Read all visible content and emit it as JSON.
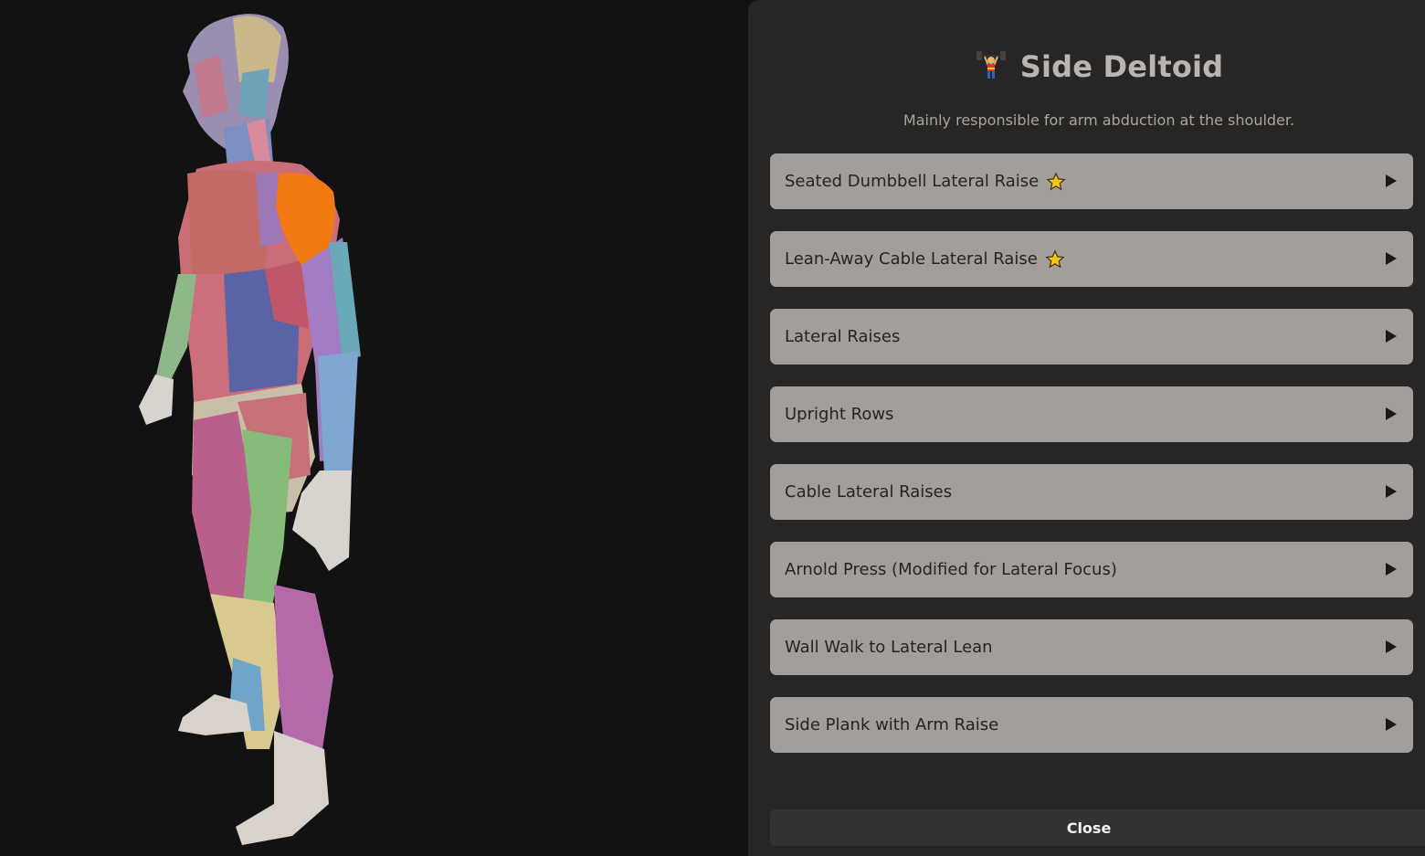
{
  "modal": {
    "icon": "weightlifter-icon",
    "title": "Side Deltoid",
    "description": "Mainly responsible for arm abduction at the shoulder.",
    "close_label": "Close"
  },
  "exercises": [
    {
      "label": "Seated Dumbbell Lateral Raise",
      "starred": true
    },
    {
      "label": "Lean-Away Cable Lateral Raise",
      "starred": true
    },
    {
      "label": "Lateral Raises",
      "starred": false
    },
    {
      "label": "Upright Rows",
      "starred": false
    },
    {
      "label": "Cable Lateral Raises",
      "starred": false
    },
    {
      "label": "Arnold Press (Modified for Lateral Focus)",
      "starred": false
    },
    {
      "label": "Wall Walk to Lateral Lean",
      "starred": false
    },
    {
      "label": "Side Plank with Arm Raise",
      "starred": false
    }
  ],
  "colors": {
    "highlight_muscle": "#f07a10",
    "panel_bg": "#282624",
    "item_bg": "#a19e9c",
    "star": "#f5c518"
  }
}
